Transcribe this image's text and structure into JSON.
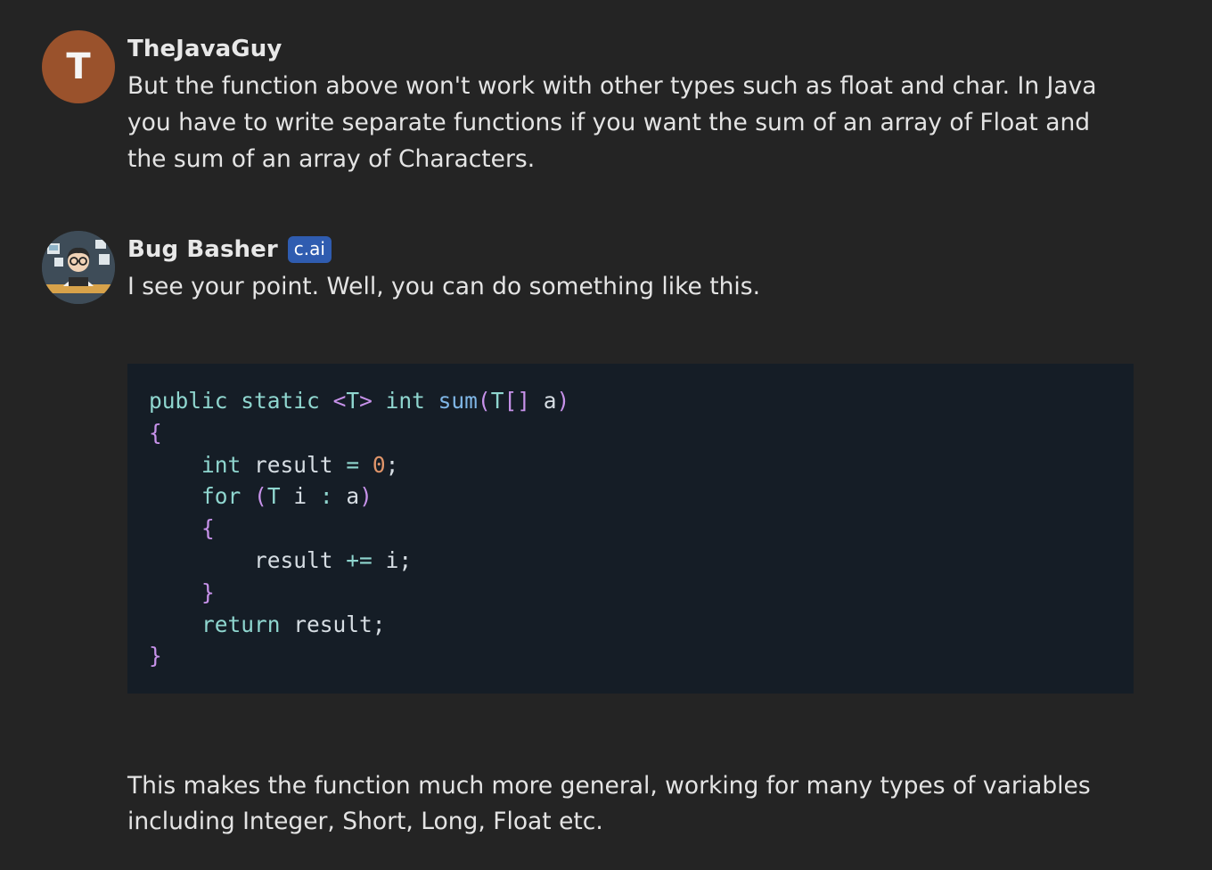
{
  "messages": [
    {
      "author": "TheJavaGuy",
      "avatar_letter": "T",
      "text": "But the function above won't work with other types such as float and char. In Java you have to write separate functions if you want the sum of an array of Float and the sum of an array of Characters."
    },
    {
      "author": "Bug Basher",
      "badge": "c.ai",
      "text": "I see your point. Well, you can do something like this.",
      "code_lines": [
        "public static <T> int sum(T[] a)",
        "{",
        "    int result = 0;",
        "    for (T i : a)",
        "    {",
        "        result += i;",
        "    }",
        "    return result;",
        "}"
      ],
      "after_text": "This makes the function much more general, working for many types of variables including Integer, Short, Long, Float etc."
    }
  ],
  "colors": {
    "background": "#242424",
    "code_background": "#151d26",
    "avatar_t": "#9a522c",
    "badge": "#2f5cb0"
  },
  "icons": {
    "bot_avatar": "programmer-avatar-icon"
  }
}
